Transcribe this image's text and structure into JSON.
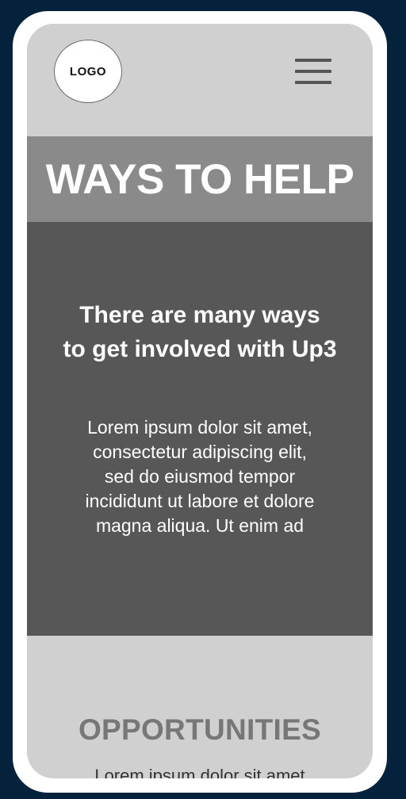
{
  "header": {
    "logo_text": "LOGO",
    "menu_icon": "hamburger-menu-icon"
  },
  "hero": {
    "title": "WAYS TO HELP"
  },
  "intro": {
    "heading_line1": "There are many ways",
    "heading_line2": "to get involved with Up3",
    "body_line1": "Lorem ipsum dolor sit amet,",
    "body_line2": "consectetur adipiscing elit,",
    "body_line3": "sed do eiusmod tempor",
    "body_line4": "incididunt ut labore et dolore",
    "body_line5": "magna aliqua. Ut enim ad"
  },
  "opportunities": {
    "heading": "OPPORTUNITIES",
    "peek_text": "Lorem ipsum dolor sit amet"
  },
  "colors": {
    "page_background": "#04223c",
    "device_frame": "#ffffff",
    "header_background": "#d0d0d0",
    "title_band": "#8a8a8a",
    "dark_panel": "#575757",
    "opportunities_text": "#777777"
  }
}
